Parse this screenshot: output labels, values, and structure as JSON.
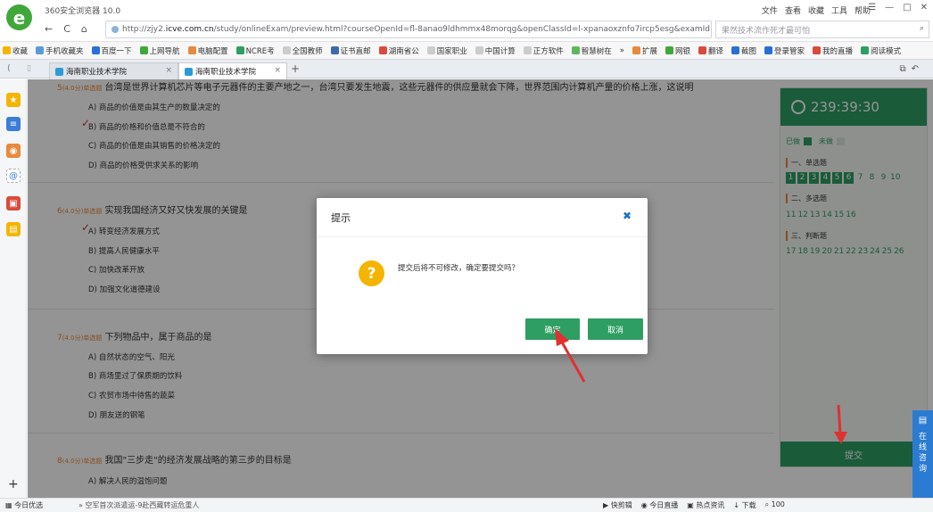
{
  "browser": {
    "title": "360安全浏览器 10.0",
    "menu": [
      "文件",
      "查看",
      "收藏",
      "工具",
      "帮助"
    ],
    "window_controls": [
      "☰",
      "—",
      "□",
      "✕"
    ],
    "url_prefix": "http://zjy2.",
    "url_domain": "icve.com.cn",
    "url_rest": "/study/onlineExam/preview.html?courseOpenId=fl-8anao9ldhmmx48morqg&openClassId=l-xpanaoxznfo7ircp5esg&examId",
    "search_placeholder": "果然技术流作死才最可怕"
  },
  "bookmarks": [
    "收藏",
    "手机收藏夹",
    "百度一下",
    "上网导航",
    "电脑配置",
    "NCRE考",
    "全国教师",
    "证书直邮",
    "湖南省公",
    "国家职业",
    "中国计算",
    "正方软件",
    "智慧树在",
    "»",
    "扩展",
    "网银",
    "翻译",
    "截图",
    "登录管家",
    "我的直播",
    "阅读模式"
  ],
  "tabs": [
    {
      "label": "海南职业技术学院"
    },
    {
      "label": "海南职业技术学院"
    }
  ],
  "questions": [
    {
      "number": "5",
      "points": "(4.0分)单选题",
      "text": "台湾是世界计算机芯片等电子元器件的主要产地之一，台湾只要发生地震，这些元器件的供应量就会下降，世界范围内计算机产量的价格上涨，这说明",
      "options": [
        {
          "text": "A) 商品的价值是由其生产的数量决定的",
          "checked": false
        },
        {
          "text": "B) 商品的价格和价值总是不符合的",
          "checked": true
        },
        {
          "text": "C) 商品的价值是由其销售的价格决定的",
          "checked": false
        },
        {
          "text": "D) 商品的价格受供求关系的影响",
          "checked": false
        }
      ]
    },
    {
      "number": "6",
      "points": "(4.0分)单选题",
      "text": "实现我国经济又好又快发展的关键是",
      "options": [
        {
          "text": "A) 转变经济发展方式",
          "checked": true
        },
        {
          "text": "B) 提高人民健康水平",
          "checked": false
        },
        {
          "text": "C) 加快改革开放",
          "checked": false
        },
        {
          "text": "D) 加强文化道德建设",
          "checked": false
        }
      ]
    },
    {
      "number": "7",
      "points": "(4.0分)单选题",
      "text": "下列物品中，属于商品的是",
      "options": [
        {
          "text": "A) 自然状态的空气、阳光",
          "checked": false
        },
        {
          "text": "B) 商场里过了保质期的饮料",
          "checked": false
        },
        {
          "text": "C) 农贸市场中待售的蔬菜",
          "checked": false
        },
        {
          "text": "D) 朋友送的钢笔",
          "checked": false
        }
      ]
    },
    {
      "number": "8",
      "points": "(4.0分)单选题",
      "text": "我国\"三步走\"的经济发展战略的第三步的目标是",
      "options": [
        {
          "text": "A) 解决人民的温饱问题",
          "checked": false
        }
      ]
    }
  ],
  "panel": {
    "timer": "239:39:30",
    "legend_done": "已做",
    "legend_undone": "未做",
    "sections": [
      {
        "title": "一、单选题",
        "numbers": [
          "1",
          "2",
          "3",
          "4",
          "5",
          "6",
          "7",
          "8",
          "9",
          "10"
        ],
        "done_count": 6
      },
      {
        "title": "二、多选题",
        "numbers": [
          "11",
          "12",
          "13",
          "14",
          "15",
          "16"
        ],
        "done_count": 0
      },
      {
        "title": "三、判断题",
        "numbers": [
          "17",
          "18",
          "19",
          "20",
          "21",
          "22",
          "23",
          "24",
          "25",
          "26"
        ],
        "done_count": 0
      }
    ],
    "submit_label": "提交"
  },
  "dialog": {
    "title": "提示",
    "close": "✖",
    "message": "提交后将不可修改，确定要提交吗？",
    "ok_label": "确定",
    "cancel_label": "取消"
  },
  "chat": {
    "label": "在线咨询"
  },
  "statusbar": {
    "left": "今日优选",
    "news": "空军首次派遣运-9赴西藏转运危重人",
    "right": [
      "快剪辑",
      "今日直播",
      "热点资讯",
      "下载"
    ],
    "zoom": "100"
  },
  "colors": {
    "accent": "#2e9e62",
    "warning": "#f5b400",
    "orange": "#e8893c",
    "link": "#1a73c8"
  }
}
